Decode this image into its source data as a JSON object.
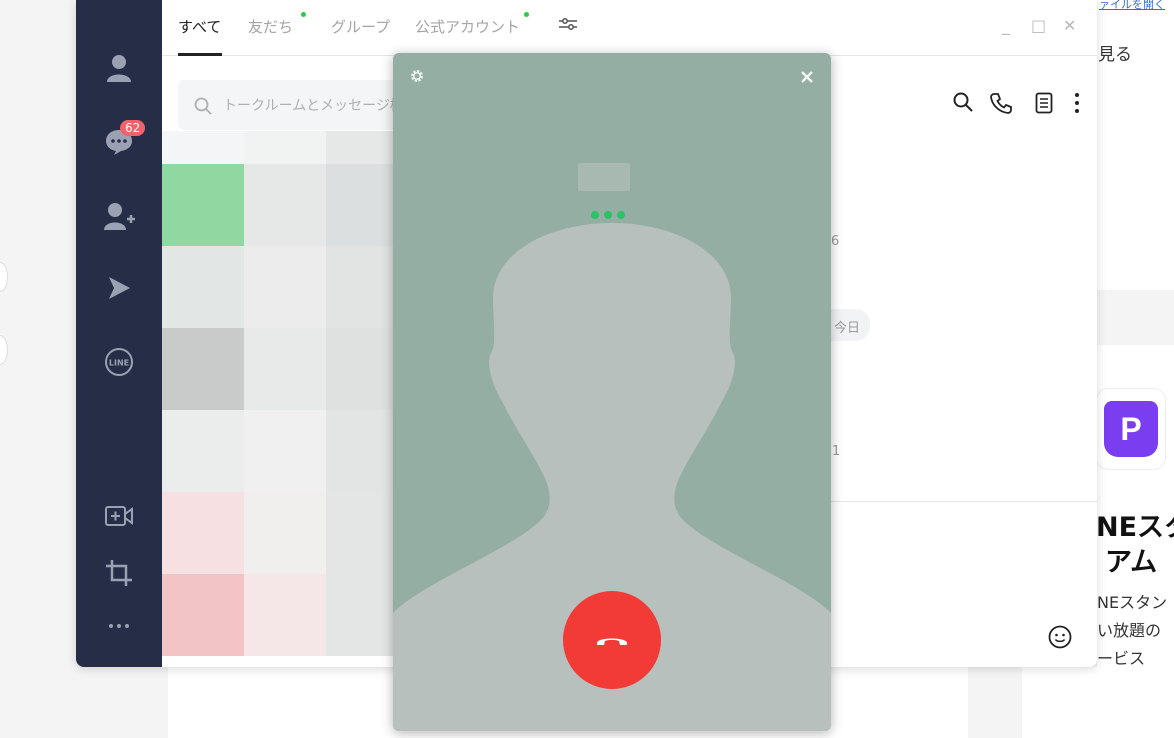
{
  "background": {
    "link_text": "ァイルを開く",
    "see_text": "見る",
    "promo_title_line1": "NEスタ",
    "promo_title_line2": "アム",
    "promo_desc_line1": "NEスタン",
    "promo_desc_line2": "い放題の",
    "promo_desc_line3": "ービス",
    "promo_icon": "P"
  },
  "sidebar": {
    "unread_badge": "62",
    "icons": [
      "person-icon",
      "chat-icon",
      "add-friend-icon",
      "voom-icon",
      "line-icon",
      "video-call-icon",
      "crop-icon",
      "more-icon"
    ]
  },
  "tabs": [
    {
      "label": "すべて",
      "active": true,
      "has_dot": false
    },
    {
      "label": "友だち",
      "active": false,
      "has_dot": true
    },
    {
      "label": "グループ",
      "active": false,
      "has_dot": false
    },
    {
      "label": "公式アカウント",
      "active": false,
      "has_dot": true
    }
  ],
  "window_controls": {
    "minimize": "_",
    "maximize": "□",
    "close": "✕"
  },
  "search": {
    "placeholder": "トークルームとメッセージ検"
  },
  "chat": {
    "date_label": "今日",
    "partial_time_1": "6",
    "partial_time_2": "1"
  },
  "call": {
    "status": "calling",
    "accent_color": "#f23a36"
  },
  "colors": {
    "sidebar": "#262e47",
    "call_bg": "#95aea4",
    "badge": "#f3616b",
    "green": "#2dc94a"
  }
}
